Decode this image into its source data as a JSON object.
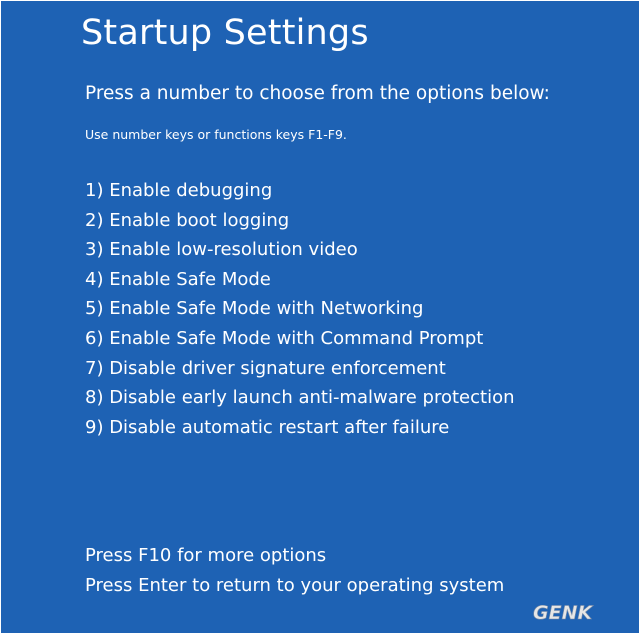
{
  "screen": {
    "title": "Startup Settings",
    "subtitle": "Press a number to choose from the options below:",
    "hint": "Use number keys or functions keys F1-F9.",
    "options": [
      {
        "label": "1) Enable debugging"
      },
      {
        "label": "2) Enable boot logging"
      },
      {
        "label": "3) Enable low-resolution video"
      },
      {
        "label": "4) Enable Safe Mode"
      },
      {
        "label": "5) Enable Safe Mode with Networking"
      },
      {
        "label": "6) Enable Safe Mode with Command Prompt"
      },
      {
        "label": "7) Disable driver signature enforcement"
      },
      {
        "label": "8) Disable early launch anti-malware protection"
      },
      {
        "label": "9) Disable automatic restart after failure"
      }
    ],
    "footer": {
      "more_options": "Press F10 for more options",
      "return": "Press Enter to return to your operating system"
    }
  },
  "watermark": {
    "text": "GENK"
  },
  "colors": {
    "background": "#1e62b4",
    "text": "#ffffff",
    "watermark": "#e6e6e6"
  }
}
